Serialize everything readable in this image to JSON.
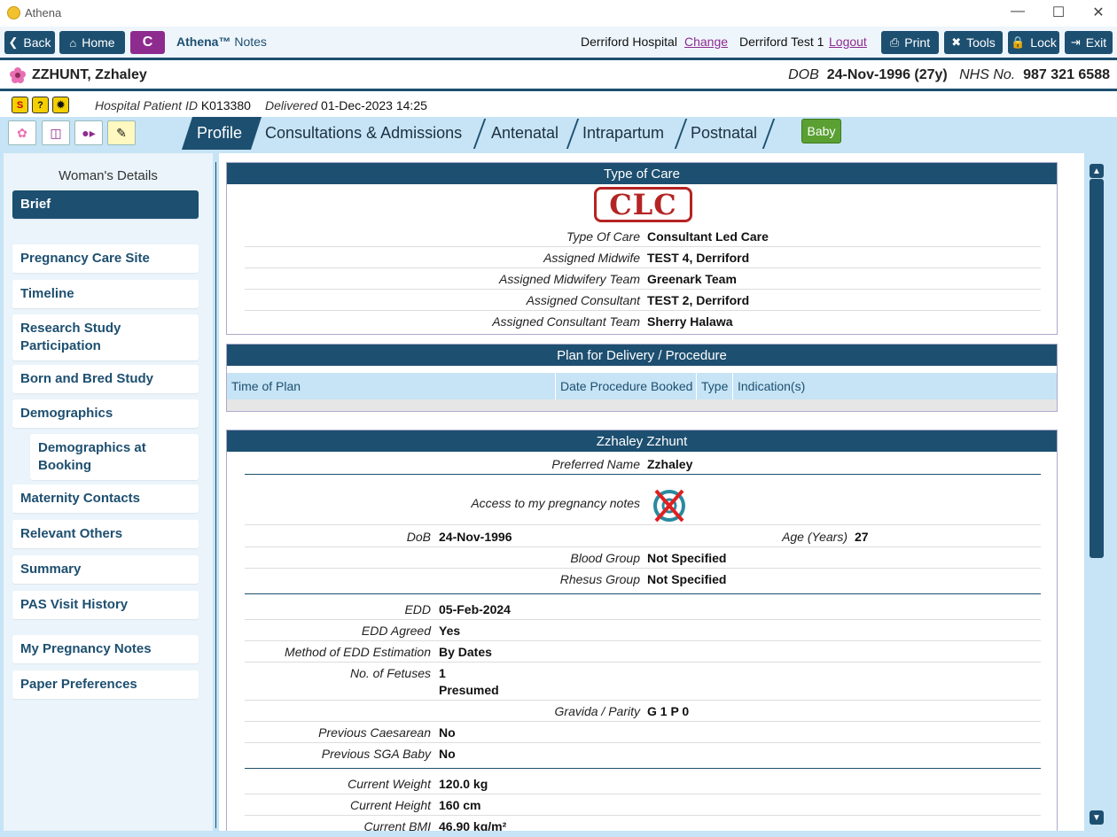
{
  "window": {
    "title": "Athena"
  },
  "toolbar": {
    "back_label": "Back",
    "home_label": "Home",
    "c_label": "C",
    "app_brand": "Athena™",
    "app_module": "Notes",
    "hospital": "Derriford Hospital",
    "change_label": "Change",
    "user": "Derriford Test 1",
    "logout_label": "Logout",
    "print_label": "Print",
    "tools_label": "Tools",
    "lock_label": "Lock",
    "exit_label": "Exit"
  },
  "patient": {
    "name": "ZZHUNT, Zzhaley",
    "dob_label": "DOB",
    "dob": "24-Nov-1996 (27y)",
    "nhs_label": "NHS No.",
    "nhs": "987 321 6588",
    "hospital_id_label": "Hospital Patient ID",
    "hospital_id": "K013380",
    "delivered_label": "Delivered",
    "delivered": "01-Dec-2023 14:25"
  },
  "tabs": {
    "profile": "Profile",
    "consultations": "Consultations & Admissions",
    "antenatal": "Antenatal",
    "intrapartum": "Intrapartum",
    "postnatal": "Postnatal",
    "baby": "Baby"
  },
  "sidebar": {
    "title": "Woman's Details",
    "items": [
      "Brief",
      "Pregnancy Care Site",
      "Timeline",
      "Research Study Participation",
      "Born and Bred Study",
      "Demographics",
      "Demographics at Booking",
      "Maternity Contacts",
      "Relevant Others",
      "Summary",
      "PAS Visit History",
      "My Pregnancy Notes",
      "Paper Preferences"
    ]
  },
  "type_of_care": {
    "header": "Type of Care",
    "stamp": "CLC",
    "rows": [
      {
        "label": "Type Of Care",
        "value": "Consultant Led Care"
      },
      {
        "label": "Assigned Midwife",
        "value": "TEST 4, Derriford"
      },
      {
        "label": "Assigned Midwifery Team",
        "value": "Greenark Team"
      },
      {
        "label": "Assigned Consultant",
        "value": "TEST 2, Derriford"
      },
      {
        "label": "Assigned Consultant Team",
        "value": "Sherry Halawa"
      }
    ]
  },
  "plan": {
    "header": "Plan for Delivery / Procedure",
    "columns": [
      "Time of Plan",
      "Date Procedure Booked",
      "Type",
      "Indication(s)"
    ]
  },
  "woman": {
    "header": "Zzhaley Zzhunt",
    "preferred_name_label": "Preferred Name",
    "preferred_name": "Zzhaley",
    "access_label": "Access to my pregnancy notes",
    "dob_label": "DoB",
    "dob": "24-Nov-1996",
    "age_label": "Age (Years)",
    "age": "27",
    "blood_group_label": "Blood Group",
    "blood_group": "Not Specified",
    "rhesus_label": "Rhesus Group",
    "rhesus": "Not Specified",
    "edd_label": "EDD",
    "edd": "05-Feb-2024",
    "edd_agreed_label": "EDD Agreed",
    "edd_agreed": "Yes",
    "method_label": "Method of EDD Estimation",
    "method": "By Dates",
    "fetuses_label": "No. of Fetuses",
    "fetuses": "1",
    "fetuses_note": "Presumed",
    "gravida_label": "Gravida / Parity",
    "gravida": "G 1 P 0",
    "prev_caesarean_label": "Previous Caesarean",
    "prev_caesarean": "No",
    "prev_sga_label": "Previous SGA Baby",
    "prev_sga": "No",
    "weight_label": "Current Weight",
    "weight": "120.0 kg",
    "height_label": "Current Height",
    "height": "160 cm",
    "bmi_label": "Current BMI",
    "bmi": "46.90 kg/m²"
  },
  "colors": {
    "primary": "#1d4f70",
    "accent": "#8e2b8f",
    "light_blue": "#c6e4f5",
    "baby_green": "#5aa033"
  }
}
